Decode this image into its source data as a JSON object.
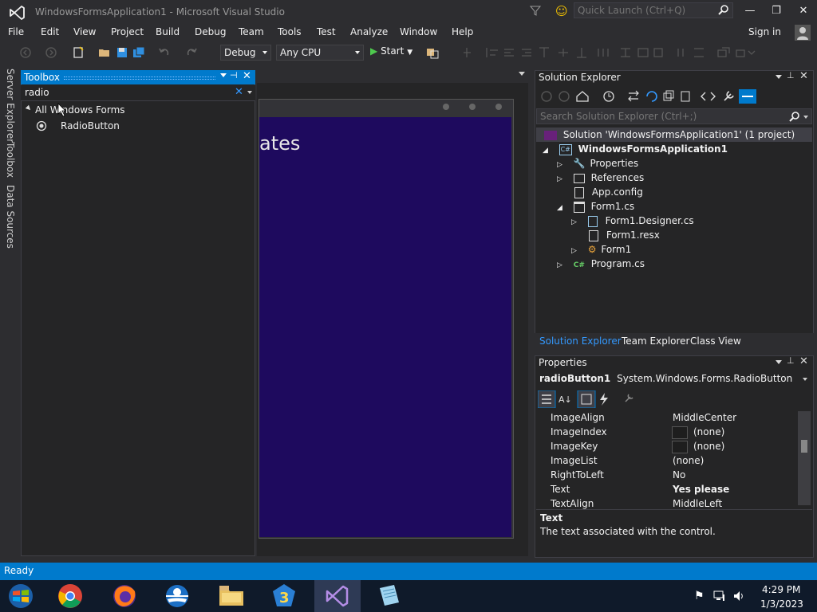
{
  "window": {
    "title": "WindowsFormsApplication1 - Microsoft Visual Studio"
  },
  "quick_launch": {
    "placeholder": "Quick Launch (Ctrl+Q)"
  },
  "menu": {
    "items": [
      "File",
      "Edit",
      "View",
      "Project",
      "Build",
      "Debug",
      "Team",
      "Tools",
      "Test",
      "Analyze",
      "Window",
      "Help"
    ],
    "sign_in": "Sign in"
  },
  "toolbar": {
    "config": "Debug",
    "platform": "Any CPU",
    "start": "Start"
  },
  "side_tabs": [
    "Server Explorer",
    "Toolbox",
    "Data Sources"
  ],
  "toolbox": {
    "title": "Toolbox",
    "search_value": "radio",
    "group": "All Windows Forms",
    "item": "RadioButton"
  },
  "designer": {
    "partial_text": "ates"
  },
  "solution_explorer": {
    "title": "Solution Explorer",
    "search_placeholder": "Search Solution Explorer (Ctrl+;)",
    "tree": [
      {
        "label": "Solution 'WindowsFormsApplication1' (1 project)",
        "indent": 0,
        "icon": "solution-icon"
      },
      {
        "label": "WindowsFormsApplication1",
        "indent": 1,
        "icon": "csharp-project-icon",
        "bold": true
      },
      {
        "label": "Properties",
        "indent": 2,
        "icon": "wrench-icon"
      },
      {
        "label": "References",
        "indent": 2,
        "icon": "references-icon"
      },
      {
        "label": "App.config",
        "indent": 2,
        "icon": "config-file-icon"
      },
      {
        "label": "Form1.cs",
        "indent": 2,
        "icon": "form-icon"
      },
      {
        "label": "Form1.Designer.cs",
        "indent": 3,
        "icon": "cs-file-icon"
      },
      {
        "label": "Form1.resx",
        "indent": 3,
        "icon": "resx-file-icon"
      },
      {
        "label": "Form1",
        "indent": 3,
        "icon": "class-icon"
      },
      {
        "label": "Program.cs",
        "indent": 2,
        "icon": "csharp-file-icon"
      }
    ],
    "tabs": [
      "Solution Explorer",
      "Team Explorer",
      "Class View"
    ]
  },
  "properties": {
    "title": "Properties",
    "object_name": "radioButton1",
    "object_type": "System.Windows.Forms.RadioButton",
    "rows": [
      {
        "name": "ImageAlign",
        "value": "MiddleCenter"
      },
      {
        "name": "ImageIndex",
        "value": "(none)",
        "swatch": true
      },
      {
        "name": "ImageKey",
        "value": "(none)",
        "swatch": true
      },
      {
        "name": "ImageList",
        "value": "(none)"
      },
      {
        "name": "RightToLeft",
        "value": "No"
      },
      {
        "name": "Text",
        "value": "Yes please",
        "bold": true
      },
      {
        "name": "TextAlign",
        "value": "MiddleLeft"
      }
    ],
    "desc_title": "Text",
    "desc_text": "The text associated with the control."
  },
  "status": {
    "text": "Ready"
  },
  "taskbar": {
    "time": "4:29 PM",
    "date": "1/3/2023"
  },
  "colors": {
    "accent": "#007acc",
    "form_bg": "#1e0a5e"
  }
}
